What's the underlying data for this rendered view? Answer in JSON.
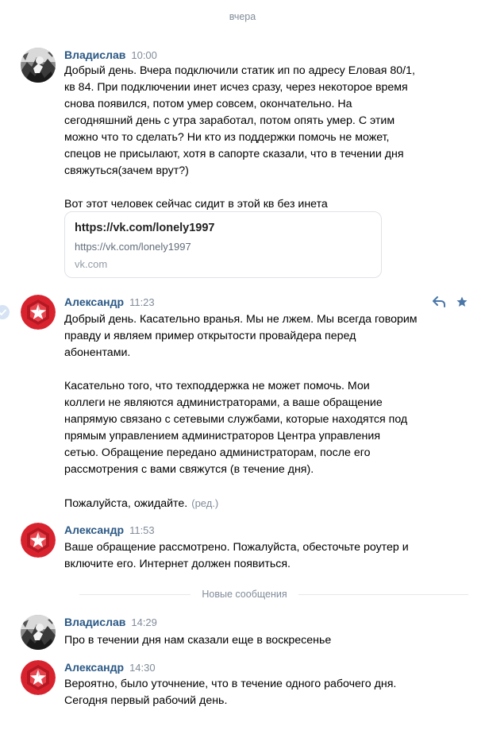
{
  "date_separator": "вчера",
  "new_messages_label": "Новые сообщения",
  "colors": {
    "author": "#2a5885",
    "meta": "#818c99",
    "accent": "#4a76a8",
    "brand_red": "#d8232f"
  },
  "messages": [
    {
      "author": "Владислав",
      "time": "10:00",
      "avatar_icon": "user-photo",
      "paragraphs": [
        "Добрый день. Вчера подключили статик ип по адресу Еловая 80/1,\nкв 84. При подключении инет исчез сразу, через некоторое время\nснова появился, потом умер совсем, окончательно. На\nсегодняшний день с утра заработал, потом опять умер. С этим\nможно что то сделать? Ни кто из поддержки помочь не может,\nспецов не присылают, хотя в сапорте сказали, что в течении дня\nсвяжуться(зачем врут?)",
        "Вот этот человек сейчас сидит в этой кв без инета"
      ],
      "link": {
        "title": "https://vk.com/lonely1997",
        "url": "https://vk.com/lonely1997",
        "domain": "vk.com"
      }
    },
    {
      "author": "Александр",
      "time": "11:23",
      "avatar_icon": "provider-logo",
      "paragraphs": [
        "Добрый день. Касательно вранья. Мы не лжем. Мы всегда говорим\nправду и являем пример открытости провайдера перед\nабонентами.",
        "Касательно того, что техподдержка не может помочь. Мои\nколлеги не являются администраторами, а ваше обращение\nнапрямую связано с сетевыми службами, которые находятся под\nпрямым управлением администраторов Центра управления\nсетью. Обращение передано администраторам, после его\nрассмотрения с вами свяжутся (в течение дня).",
        "Пожалуйста, ожидайте."
      ],
      "edited_label": "(ред.)"
    },
    {
      "author": "Александр",
      "time": "11:53",
      "avatar_icon": "provider-logo",
      "paragraphs": [
        "Ваше обращение рассмотрено. Пожалуйста, обесточьте роутер и\nвключите его. Интернет должен появиться."
      ]
    },
    {
      "author": "Владислав",
      "time": "14:29",
      "avatar_icon": "user-photo",
      "paragraphs": [
        "Про в течении дня нам сказали еще в воскресенье"
      ]
    },
    {
      "author": "Александр",
      "time": "14:30",
      "avatar_icon": "provider-logo",
      "paragraphs": [
        "Вероятно, было уточнение, что в течение одного рабочего дня.\nСегодня первый рабочий день."
      ]
    }
  ]
}
